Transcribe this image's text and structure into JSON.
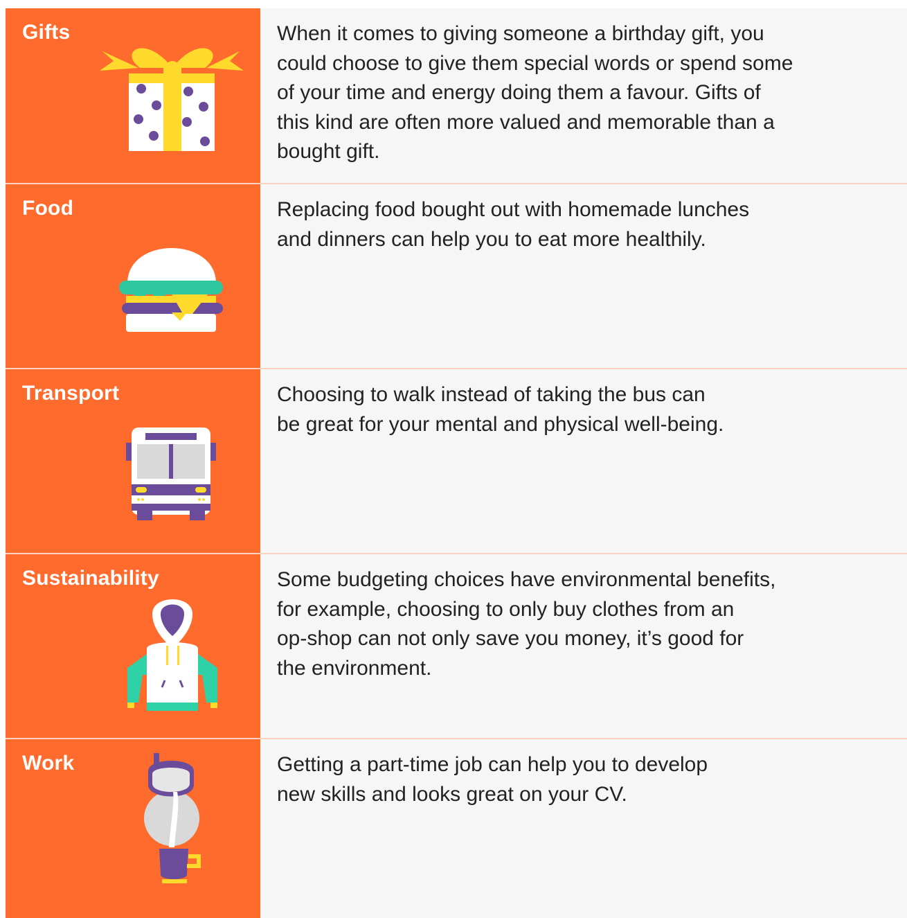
{
  "rows": [
    {
      "label": "Gifts",
      "icon": "gift-box-icon",
      "description": "When it comes to giving someone a birthday gift, you\ncould choose to give them special words or spend some\nof your time and energy doing them a favour. Gifts of\nthis kind are often more valued and memorable than a\nbought gift."
    },
    {
      "label": "Food",
      "icon": "burger-icon",
      "description": "Replacing food bought out with homemade lunches\nand dinners can help you to eat more healthily."
    },
    {
      "label": "Transport",
      "icon": "bus-icon",
      "description": "Choosing to walk instead of taking the bus can\nbe great for your mental and physical well-being."
    },
    {
      "label": "Sustainability",
      "icon": "hoodie-icon",
      "description": "Some budgeting choices have environmental benefits,\nfor example, choosing to only buy clothes from an\nop-shop can not only save you money, it’s good for\nthe environment."
    },
    {
      "label": "Work",
      "icon": "milk-jug-cup-icon",
      "description": "Getting a part-time job can help you to develop\nnew skills and looks great on your CV."
    }
  ],
  "colors": {
    "label_background": "#ff6b2d",
    "description_background": "#f6f6f6",
    "divider": "#fbd2c1",
    "purple": "#6b4c9a",
    "yellow": "#ffd92b",
    "teal": "#2fd1a6"
  }
}
